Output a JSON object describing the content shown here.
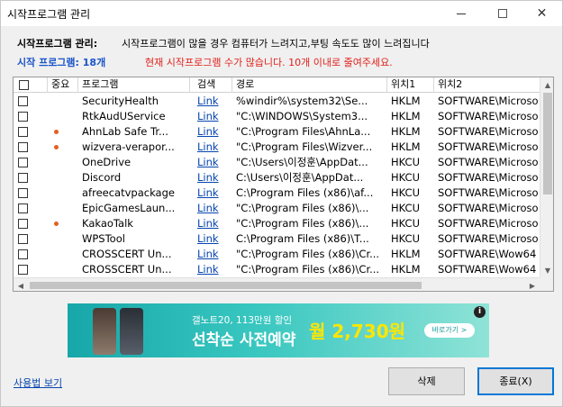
{
  "window": {
    "title": "시작프로그램 관리",
    "min_glyph": "—",
    "close_glyph": "✕"
  },
  "info": {
    "mgmt_label": "시작프로그램 관리:",
    "description": "시작프로그램이 많을 경우 컴퓨터가 느려지고,부팅 속도도 많이 느려집니다",
    "count_label": "시작 프로그램: 18개",
    "warning": "현재 시작프로그램 수가 많습니다. 10개 이내로 줄여주세요."
  },
  "columns": {
    "important": "중요",
    "program": "프로그램",
    "search": "검색",
    "path": "경로",
    "loc1": "위치1",
    "loc2": "위치2"
  },
  "rows": [
    {
      "program": "SecurityHealth",
      "link": "Link",
      "path": "%windir%\\system32\\Se...",
      "loc1": "HKLM",
      "loc2": "SOFTWARE\\Microso",
      "important": false
    },
    {
      "program": "RtkAudUService",
      "link": "Link",
      "path": "\"C:\\WINDOWS\\System3...",
      "loc1": "HKLM",
      "loc2": "SOFTWARE\\Microso",
      "important": false
    },
    {
      "program": "AhnLab Safe Tr...",
      "link": "Link",
      "path": "\"C:\\Program Files\\AhnLa...",
      "loc1": "HKLM",
      "loc2": "SOFTWARE\\Microso",
      "important": true
    },
    {
      "program": "wizvera-verapor...",
      "link": "Link",
      "path": "\"C:\\Program Files\\Wizver...",
      "loc1": "HKLM",
      "loc2": "SOFTWARE\\Microso",
      "important": true
    },
    {
      "program": "OneDrive",
      "link": "Link",
      "path": "\"C:\\Users\\이정훈\\AppDat...",
      "loc1": "HKCU",
      "loc2": "SOFTWARE\\Microso",
      "important": false
    },
    {
      "program": "Discord",
      "link": "Link",
      "path": "C:\\Users\\이정훈\\AppDat...",
      "loc1": "HKCU",
      "loc2": "SOFTWARE\\Microso",
      "important": false
    },
    {
      "program": "afreecatvpackage",
      "link": "Link",
      "path": "C:\\Program Files (x86)\\af...",
      "loc1": "HKCU",
      "loc2": "SOFTWARE\\Microso",
      "important": false
    },
    {
      "program": "EpicGamesLaun...",
      "link": "Link",
      "path": "\"C:\\Program Files (x86)\\...",
      "loc1": "HKCU",
      "loc2": "SOFTWARE\\Microso",
      "important": false
    },
    {
      "program": "KakaoTalk",
      "link": "Link",
      "path": "\"C:\\Program Files (x86)\\...",
      "loc1": "HKCU",
      "loc2": "SOFTWARE\\Microso",
      "important": true
    },
    {
      "program": "WPSTool",
      "link": "Link",
      "path": "C:\\Program Files (x86)\\T...",
      "loc1": "HKCU",
      "loc2": "SOFTWARE\\Microso",
      "important": false
    },
    {
      "program": "CROSSCERT Un...",
      "link": "Link",
      "path": "\"C:\\Program Files (x86)\\Cr...",
      "loc1": "HKLM",
      "loc2": "SOFTWARE\\Wow64",
      "important": false
    },
    {
      "program": "CROSSCERT Un...",
      "link": "Link",
      "path": "\"C:\\Program Files (x86)\\Cr...",
      "loc1": "HKLM",
      "loc2": "SOFTWARE\\Wow64",
      "important": false
    }
  ],
  "banner": {
    "line1": "갤노트20, 113만원 할인",
    "line2": "선착순 사전예약",
    "price": "월 2,730원",
    "button": "바로가기 >",
    "info_glyph": "i"
  },
  "footer": {
    "usage_link": "사용법 보기",
    "delete_label": "삭제",
    "close_label": "종료(X)"
  },
  "colors": {
    "count": "#1a53c9",
    "warning": "#e0201b",
    "link": "#0645ad",
    "important_dot": "#e2601f",
    "banner_teal": "#17a7a9",
    "banner_price": "#ffe600"
  }
}
